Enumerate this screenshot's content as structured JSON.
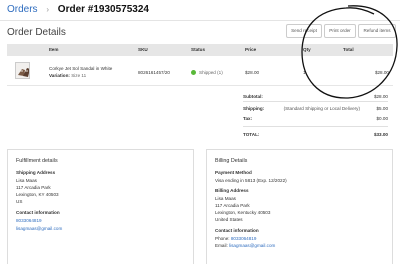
{
  "breadcrumb": {
    "parent": "Orders",
    "separator": "›",
    "order_number": "Order #1930575324"
  },
  "page_title": "Order Details",
  "actions": {
    "send_receipt": "Send receipt",
    "print_order": "Print order",
    "refund_items": "Refund items"
  },
  "table": {
    "headers": {
      "item": "Item",
      "sku": "SKU",
      "status": "Status",
      "price": "Price",
      "qty": "Qty",
      "total": "Total"
    },
    "rows": [
      {
        "name": "Corkye Jet Sol Sandal in White",
        "variation_label": "Variation:",
        "variation_value": "Size 11",
        "sku": "8026161457/20",
        "status": "Shipped (1)",
        "price": "$28.00",
        "qty": "1",
        "total": "$28.00"
      }
    ]
  },
  "summary": {
    "subtotal_label": "Subtotal:",
    "subtotal_value": "$28.00",
    "shipping_label": "Shipping:",
    "shipping_note": "(Standard Shipping or Local Delivery)",
    "shipping_value": "$5.00",
    "tax_label": "Tax:",
    "tax_value": "$0.00",
    "total_label": "TOTAL:",
    "total_value": "$33.00"
  },
  "fulfillment": {
    "title": "Fulfillment details",
    "shipping_heading": "Shipping Address",
    "name": "Lisa Maas",
    "street": "117 Arcadia Park",
    "city": "Lexington, KY 40503",
    "country": "US",
    "contact_heading": "Contact information",
    "phone": "8033064819",
    "email": "lisagmaas@gmail.com"
  },
  "billing": {
    "title": "Billing Details",
    "payment_heading": "Payment Method",
    "payment_value": "Visa ending in 5813 (Exp. 12/2022)",
    "address_heading": "Billing Address",
    "name": "Lisa Maas",
    "street": "117 Arcadia Park",
    "city": "Lexington, Kentucky 40503",
    "country": "United States",
    "contact_heading": "Contact information",
    "phone_label": "Phone:",
    "phone": "8033064819",
    "email_label": "Email:",
    "email": "lisagmaas@gmail.com"
  },
  "colors": {
    "link": "#2f6dbf",
    "status_shipped": "#59b839",
    "header_bg": "#e6e6e6"
  },
  "icons": {
    "status": "status-dot-icon",
    "product": "product-thumbnail"
  }
}
